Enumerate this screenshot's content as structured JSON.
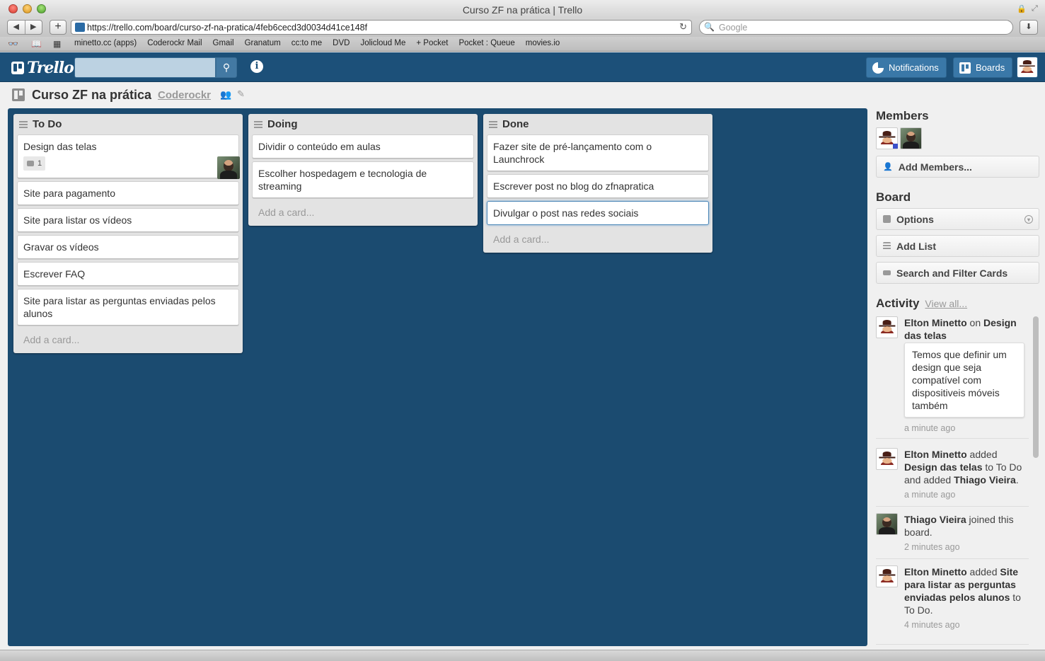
{
  "browser": {
    "window_title": "Curso ZF na prática | Trello",
    "url": "https://trello.com/board/curso-zf-na-pratica/4feb6cecd3d0034d41ce148f",
    "search_placeholder": "Google",
    "bookmarks": [
      "minetto.cc (apps)",
      "Coderockr Mail",
      "Gmail",
      "Granatum",
      "cc:to me",
      "DVD",
      "Jolicloud Me",
      "+ Pocket",
      "Pocket : Queue",
      "movies.io"
    ]
  },
  "header": {
    "logo": "Trello",
    "notifications_label": "Notifications",
    "boards_label": "Boards"
  },
  "board": {
    "title": "Curso ZF na prática",
    "organization": "Coderockr"
  },
  "lists": [
    {
      "title": "To Do",
      "cards": [
        "Design das telas",
        "Site para pagamento",
        "Site para listar os vídeos",
        "Gravar os vídeos",
        "Escrever FAQ",
        "Site para listar as perguntas enviadas pelos alunos"
      ],
      "first_card_comments": "1",
      "add_card": "Add a card..."
    },
    {
      "title": "Doing",
      "cards": [
        "Dividir o conteúdo em aulas",
        "Escolher hospedagem e tecnologia de streaming"
      ],
      "add_card": "Add a card..."
    },
    {
      "title": "Done",
      "cards": [
        "Fazer site de pré-lançamento com o Launchrock",
        "Escrever post no blog do zfnapratica",
        "Divulgar o post nas redes sociais"
      ],
      "add_card": "Add a card..."
    }
  ],
  "sidebar": {
    "members_heading": "Members",
    "add_members": "Add Members...",
    "board_heading": "Board",
    "options": "Options",
    "add_list": "Add List",
    "search_filter": "Search and Filter Cards",
    "activity_heading": "Activity",
    "view_all": "View all...",
    "activity": [
      {
        "user": "Elton Minetto",
        "t1": " on ",
        "b2": "Design das telas",
        "comment": "Temos que definir um design que seja compatível com dispositiveis móveis também",
        "time": "a minute ago"
      },
      {
        "user": "Elton Minetto",
        "t1": " added ",
        "b2": "Design das telas",
        "t2": " to To Do and added ",
        "b3": "Thiago Vieira",
        "t3": ".",
        "time": "a minute ago"
      },
      {
        "user": "Thiago Vieira",
        "t1": " joined this board.",
        "time": "2 minutes ago"
      },
      {
        "user": "Elton Minetto",
        "t1": " added ",
        "b2": "Site para listar as perguntas enviadas pelos alunos",
        "t2": " to To Do.",
        "time": "4 minutes ago"
      }
    ]
  },
  "colors": {
    "header": "#1c5079",
    "board_background": "#1e557e",
    "list_background": "#e3e3e3"
  }
}
